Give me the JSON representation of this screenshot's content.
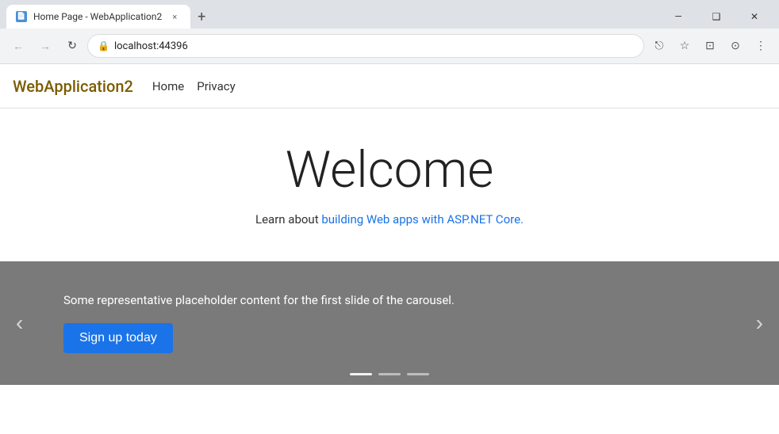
{
  "browser": {
    "tab_title": "Home Page - WebApplication2",
    "tab_close": "×",
    "new_tab": "+",
    "window_minimize": "—",
    "window_maximize": "❑",
    "window_close": "✕",
    "back_arrow": "←",
    "forward_arrow": "→",
    "refresh": "↻",
    "address": "localhost:44396",
    "lock_icon": "🔒",
    "share_icon": "⎋",
    "star_icon": "☆",
    "split_icon": "⊡",
    "profile_icon": "⊙",
    "menu_icon": "⋮"
  },
  "site_nav": {
    "brand": "WebApplication2",
    "links": [
      "Home",
      "Privacy"
    ]
  },
  "main": {
    "title": "Welcome",
    "learn_prefix": "Learn about ",
    "learn_link_text": "building Web apps with ASP.NET Core.",
    "learn_link_href": "#"
  },
  "carousel": {
    "slide_text": "Some representative placeholder content for the first slide of the carousel.",
    "signup_button": "Sign up today",
    "prev_label": "‹",
    "next_label": "›",
    "indicators": [
      {
        "active": true
      },
      {
        "active": false
      },
      {
        "active": false
      }
    ]
  }
}
